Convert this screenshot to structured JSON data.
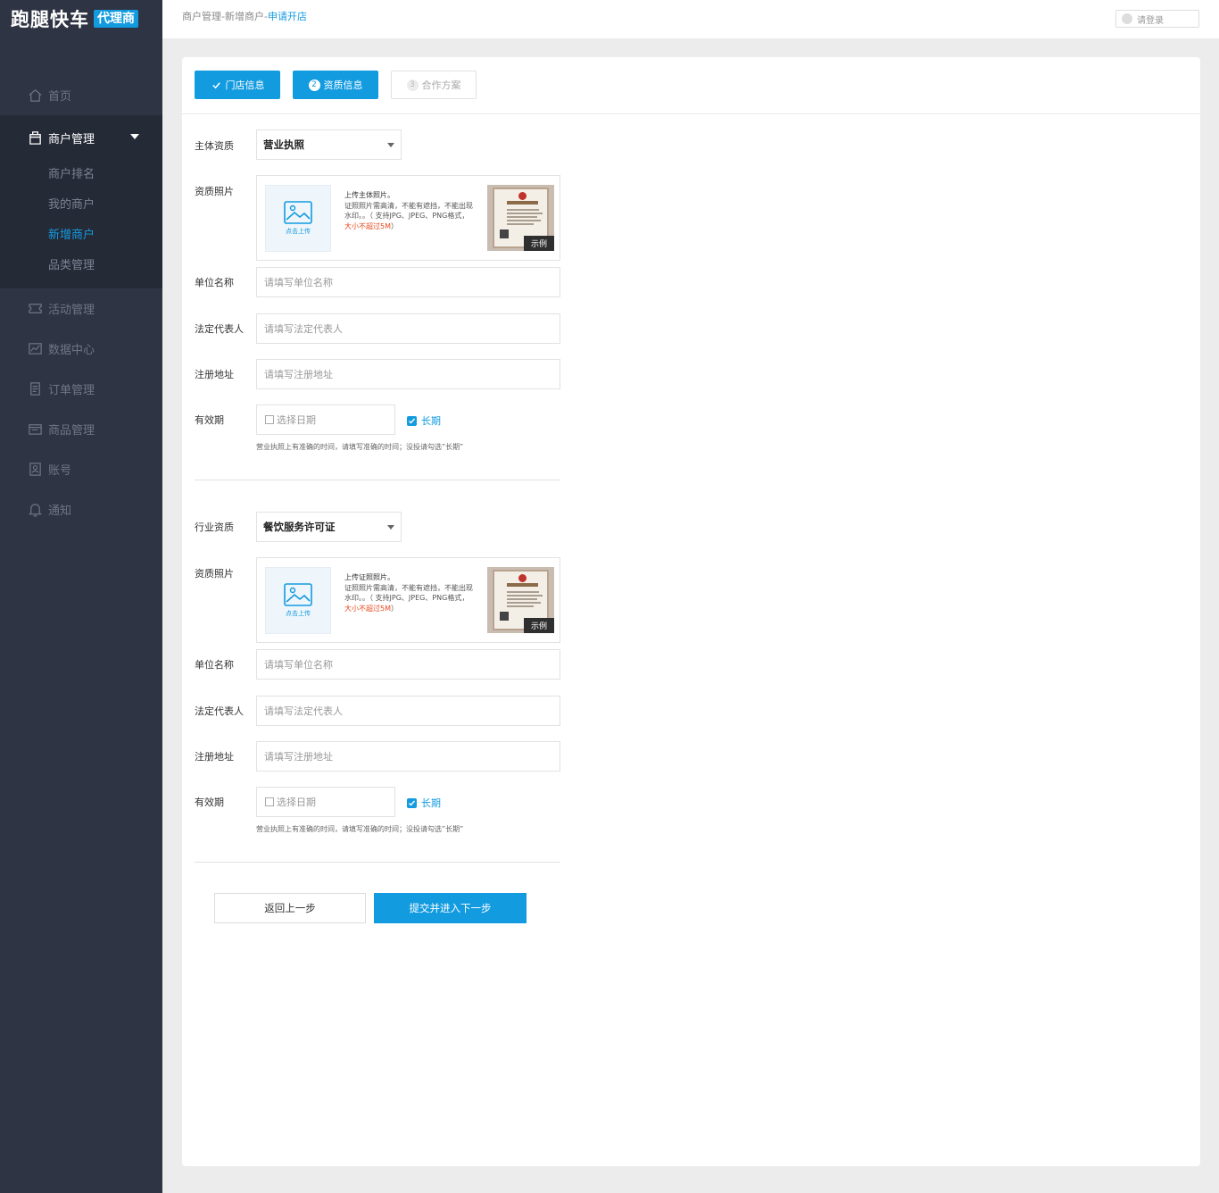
{
  "brand": {
    "name": "跑腿快车",
    "badge": "代理商"
  },
  "topbar": {
    "breadcrumb": [
      "商户管理",
      "新增商户",
      "申请开店"
    ],
    "separator": "-",
    "login_label": "请登录"
  },
  "sidebar": {
    "items": [
      {
        "label": "首页",
        "icon": "home-icon"
      },
      {
        "label": "商户管理",
        "icon": "store-icon"
      },
      {
        "label": "活动管理",
        "icon": "ticket-icon"
      },
      {
        "label": "数据中心",
        "icon": "chart-icon"
      },
      {
        "label": "订单管理",
        "icon": "order-icon"
      },
      {
        "label": "商品管理",
        "icon": "goods-icon"
      },
      {
        "label": "账号",
        "icon": "account-icon"
      },
      {
        "label": "通知",
        "icon": "bell-icon"
      }
    ],
    "sub_items": [
      "商户排名",
      "我的商户",
      "新增商户",
      "品类管理"
    ],
    "active_sub": "新增商户"
  },
  "steps": [
    {
      "label": "门店信息",
      "state": "done"
    },
    {
      "num": "2",
      "label": "资质信息",
      "state": "current"
    },
    {
      "num": "3",
      "label": "合作方案",
      "state": "pending"
    }
  ],
  "sections": [
    {
      "type_label": "主体资质",
      "type_value": "营业执照",
      "photo_label": "资质照片",
      "upload_btn": "点击上传",
      "tip_title": "上传主体照片。",
      "tip_body": "证照照片需高清，不能有遮挡，不能出现水印。。（ 支持JPG、JPEG、PNG格式，",
      "tip_red": "大小不超过5M",
      "tip_end": "）",
      "sample_tag": "示例",
      "name_label": "单位名称",
      "name_placeholder": "请填写单位名称",
      "rep_label": "法定代表人",
      "rep_placeholder": "请填写法定代表人",
      "addr_label": "注册地址",
      "addr_placeholder": "请填写注册地址",
      "valid_label": "有效期",
      "date_placeholder": "选择日期",
      "long_label": "长期",
      "hint": "营业执照上有准确的时间，请填写准确的时间；没投请勾选”长期”"
    },
    {
      "type_label": "行业资质",
      "type_value": "餐饮服务许可证",
      "photo_label": "资质照片",
      "upload_btn": "点击上传",
      "tip_title": "上传证照照片。",
      "tip_body": "证照照片需高清，不能有遮挡，不能出现水印。。（ 支持JPG、JPEG、PNG格式，",
      "tip_red": "大小不超过5M",
      "tip_end": "）",
      "sample_tag": "示例",
      "name_label": "单位名称",
      "name_placeholder": "请填写单位名称",
      "rep_label": "法定代表人",
      "rep_placeholder": "请填写法定代表人",
      "addr_label": "注册地址",
      "addr_placeholder": "请填写注册地址",
      "valid_label": "有效期",
      "date_placeholder": "选择日期",
      "long_label": "长期",
      "hint": "营业执照上有准确的时间，请填写准确的时间；没投请勾选”长期”"
    }
  ],
  "actions": {
    "back": "返回上一步",
    "next": "提交并进入下一步"
  },
  "colors": {
    "accent": "#139be0",
    "sidebar": "#2f3444",
    "warn": "#e84a1e"
  }
}
